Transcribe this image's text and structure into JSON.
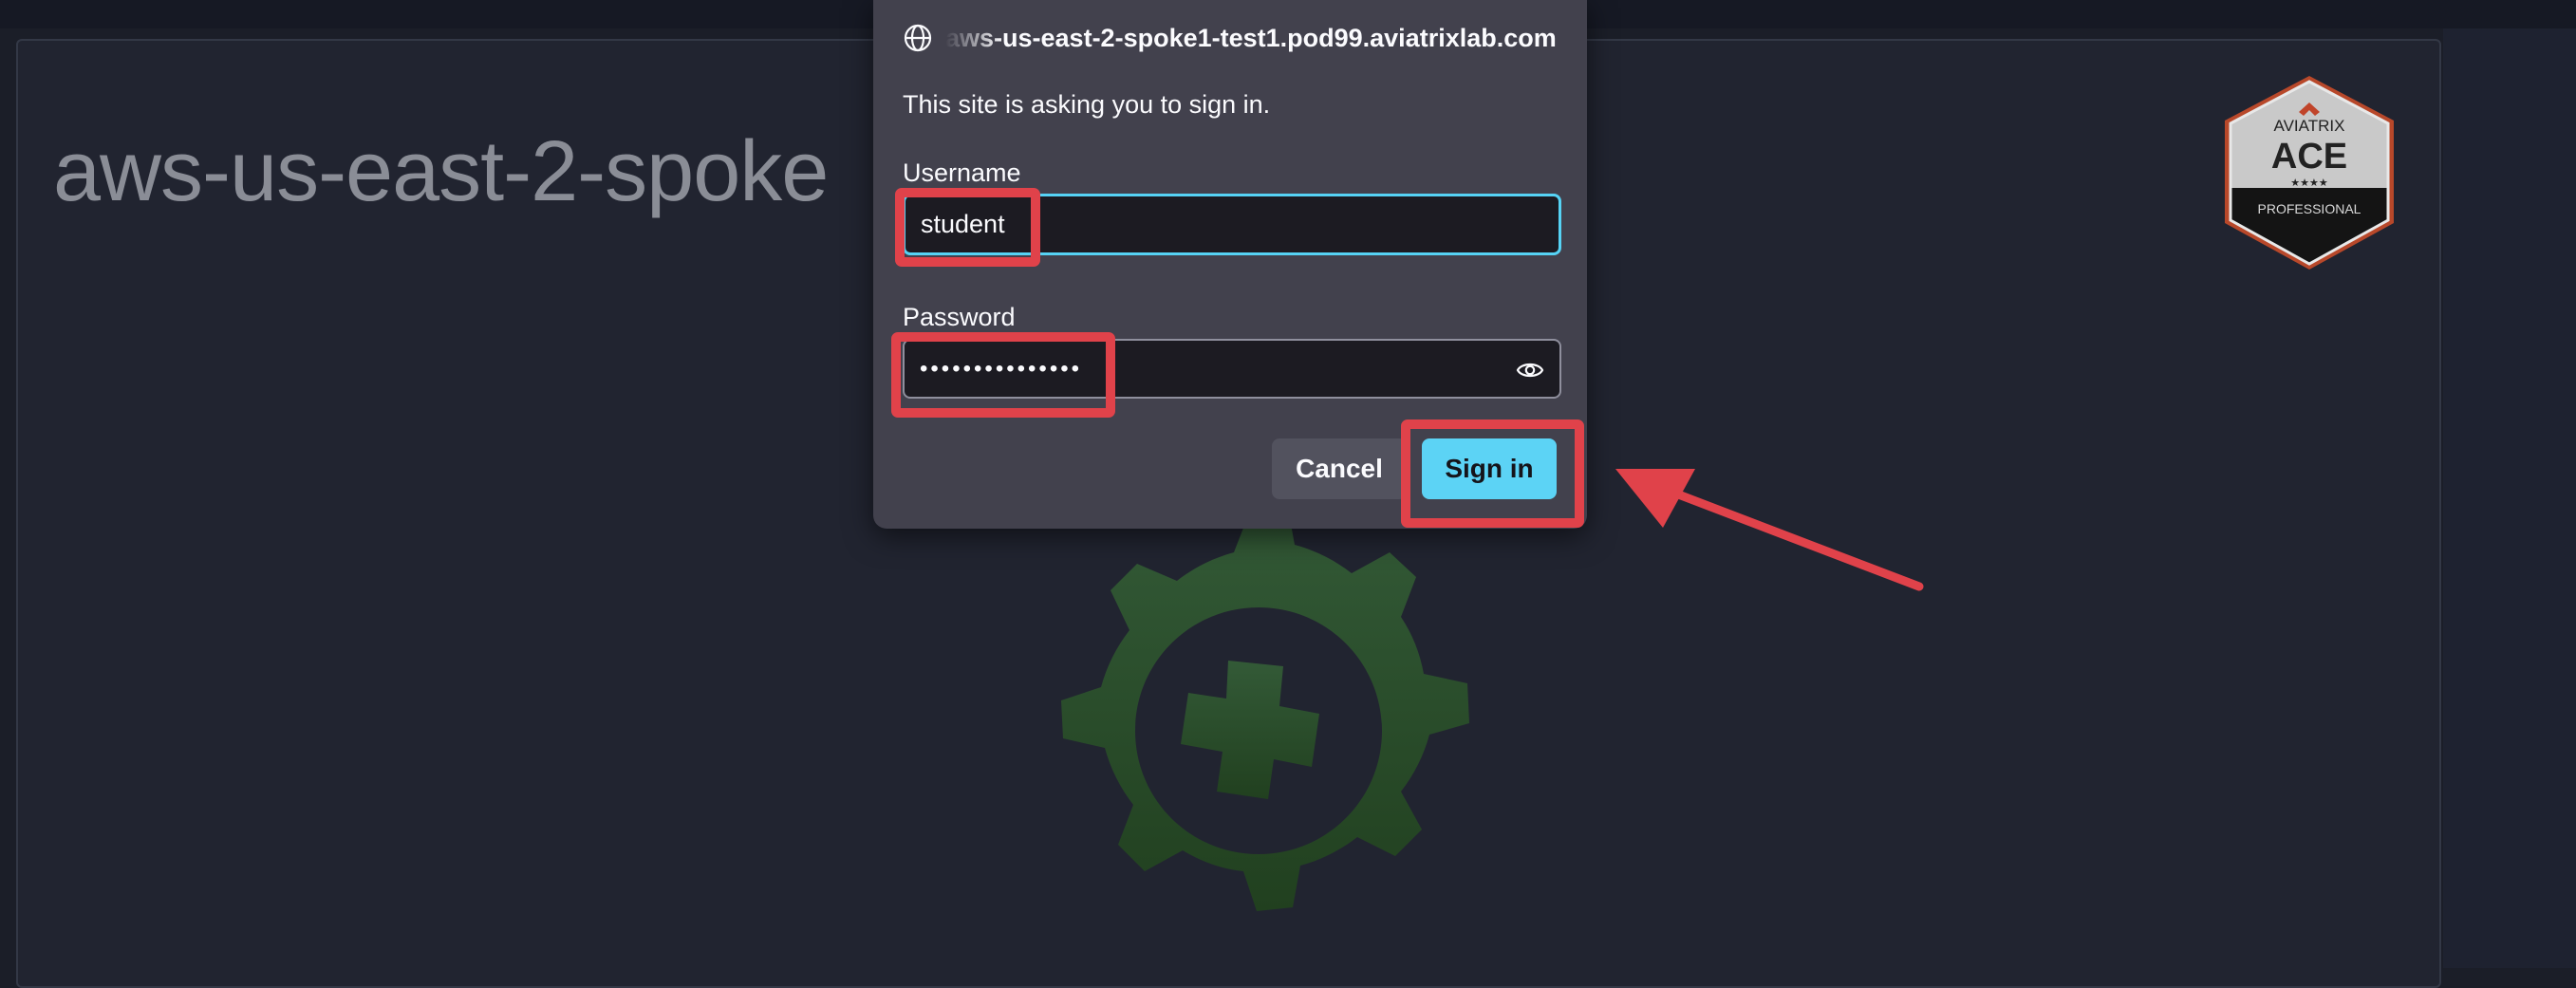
{
  "page": {
    "title": "aws-us-east-2-spoke"
  },
  "badge": {
    "brand": "AVIATRIX",
    "title": "ACE",
    "stars": "★★★★",
    "level": "PROFESSIONAL"
  },
  "dialog": {
    "origin": "aws-us-east-2-spoke1-test1.pod99.aviatrixlab.com",
    "prompt": "This site is asking you to sign in.",
    "username_label": "Username",
    "username_value": "student",
    "password_label": "Password",
    "password_value": "•••••••••••••••",
    "cancel_label": "Cancel",
    "signin_label": "Sign in"
  },
  "colors": {
    "accent": "#5cd3f5",
    "highlight": "#e0424a",
    "dialog_bg": "#42414d",
    "page_bg": "#212430"
  },
  "icons": {
    "globe": "globe-icon",
    "eye": "eye-icon",
    "gear": "gear-plus-icon"
  }
}
